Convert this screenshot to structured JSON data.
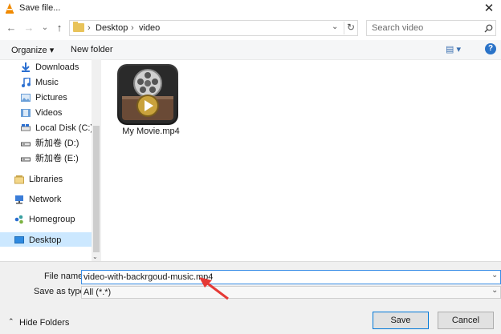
{
  "window": {
    "title": "Save file...",
    "close_glyph": "✕"
  },
  "nav": {
    "back": "←",
    "forward": "→",
    "recent": "⌄",
    "up": "↑",
    "breadcrumb": [
      "Desktop",
      "video"
    ],
    "refresh": "↻",
    "search_placeholder": "Search video"
  },
  "command_bar": {
    "organize": "Organize ▾",
    "new_folder": "New folder",
    "view": "▤ ▾",
    "help": "?"
  },
  "sidebar": {
    "items": [
      {
        "label": "Downloads",
        "icon": "download-icon",
        "color": "#2a6fd1"
      },
      {
        "label": "Music",
        "icon": "music-icon",
        "color": "#2a6fd1"
      },
      {
        "label": "Pictures",
        "icon": "pictures-icon",
        "color": "#6a9fd8"
      },
      {
        "label": "Videos",
        "icon": "videos-icon",
        "color": "#6a9fd8"
      },
      {
        "label": "Local Disk (C:)",
        "icon": "disk-icon",
        "color": "#555555"
      },
      {
        "label": "新加卷 (D:)",
        "icon": "drive-icon",
        "color": "#555555"
      },
      {
        "label": "新加卷 (E:)",
        "icon": "drive-icon",
        "color": "#555555"
      },
      {
        "label": "Libraries",
        "icon": "libraries-icon",
        "color": "#c9a44a"
      },
      {
        "label": "Network",
        "icon": "network-icon",
        "color": "#3b7dd8"
      },
      {
        "label": "Homegroup",
        "icon": "homegroup-icon",
        "color": "#3aa0a0"
      },
      {
        "label": "Desktop",
        "icon": "desktop-icon",
        "color": "#2f8ae0"
      }
    ]
  },
  "files": [
    {
      "name": "My Movie.mp4"
    }
  ],
  "form": {
    "file_name_label": "File name:",
    "file_name_value": "video-with-backrgoud-music.mp4",
    "save_type_label": "Save as type:",
    "save_type_value": "All (*.*)"
  },
  "footer": {
    "hide_folders": "Hide Folders",
    "save": "Save",
    "cancel": "Cancel"
  },
  "colors": {
    "accent": "#0078d7",
    "selection": "#cce8ff",
    "arrow": "#e53935"
  }
}
